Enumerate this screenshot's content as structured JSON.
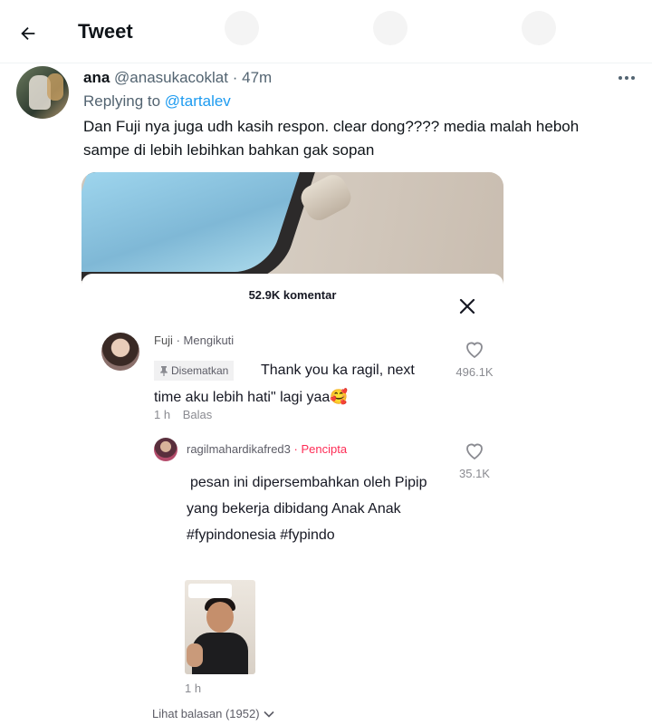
{
  "header": {
    "title": "Tweet",
    "back_icon": "arrow-left-icon"
  },
  "tweet": {
    "author_name": "ana",
    "author_handle": "@anasukacoklat",
    "separator": "·",
    "time": "47m",
    "replying_prefix": "Replying to",
    "replying_to": "@tartalev",
    "text_line1": "Dan Fuji nya juga udh kasih respon. clear dong???? media malah heboh",
    "text_line2": "sampe di lebih lebihkan bahkan gak sopan"
  },
  "media": {
    "comments_title": "52.9K komentar",
    "comment1": {
      "username": "Fuji",
      "separator": "·",
      "status": "Mengikuti",
      "pinned_label": "Disematkan",
      "text": "Thank you ka ragil, next time aku lebih hati\" lagi yaa🥰",
      "time": "1 h",
      "reply_label": "Balas",
      "likes": "496.1K"
    },
    "comment2": {
      "username": "ragilmahardikafred3",
      "separator": "·",
      "badge": "Pencipta",
      "text": "pesan ini dipersembahkan oleh Pipip yang bekerja dibidang Anak Anak #fypindonesia #fypindo",
      "time": "1 h",
      "likes": "35.1K"
    },
    "view_replies": "Lihat balasan (1952)"
  },
  "colors": {
    "link": "#1d9bf0",
    "creator": "#fe2c55",
    "muted": "#536471"
  }
}
